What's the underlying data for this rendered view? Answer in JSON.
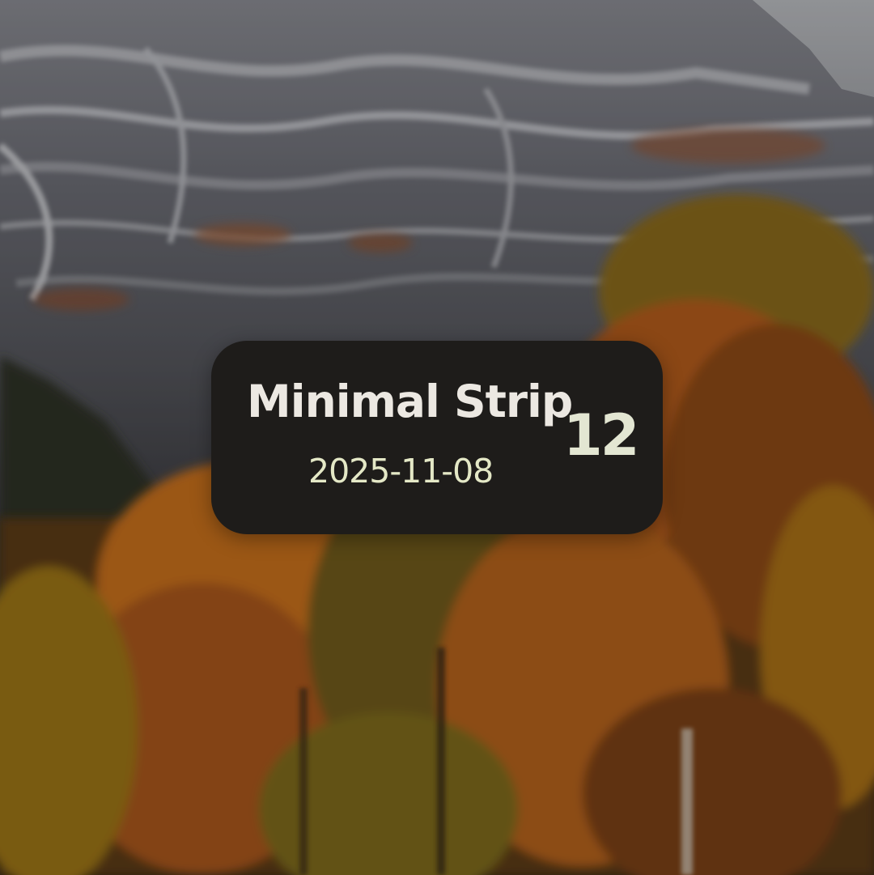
{
  "wallpaper": {
    "description_icon": "mountain-autumn-forest-wallpaper"
  },
  "widget": {
    "title": "Minimal Strip",
    "day": "12",
    "date": "2025-11-08",
    "background_color": "#1e1c1a",
    "title_color": "#ece8e2",
    "accent_color": "#e4e8c6"
  }
}
